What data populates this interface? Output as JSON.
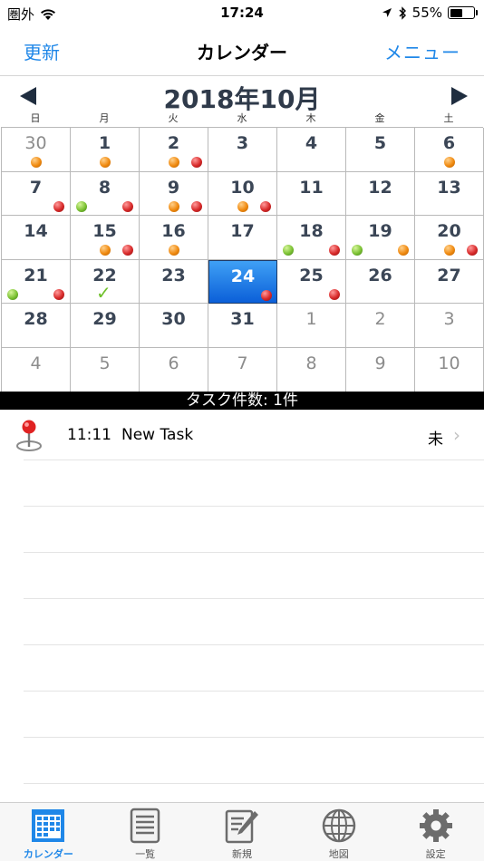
{
  "status": {
    "carrier": "圏外",
    "time": "17:24",
    "battery": "55%",
    "battery_level": 0.55,
    "icons": [
      "wifi-icon",
      "location-arrow-icon",
      "bluetooth-icon",
      "battery-icon"
    ]
  },
  "nav": {
    "left": "更新",
    "title": "カレンダー",
    "right": "メニュー"
  },
  "calendar": {
    "month_title": "2018年10月",
    "weekdays": [
      "日",
      "月",
      "火",
      "水",
      "木",
      "金",
      "土"
    ],
    "selected": "24",
    "weeks": [
      [
        {
          "d": "30",
          "other": true,
          "dots": [
            "orange"
          ]
        },
        {
          "d": "1",
          "dots": [
            "orange"
          ]
        },
        {
          "d": "2",
          "dots": [
            "orange",
            "red"
          ]
        },
        {
          "d": "3",
          "dots": []
        },
        {
          "d": "4",
          "dots": []
        },
        {
          "d": "5",
          "dots": []
        },
        {
          "d": "6",
          "dots": [
            "orange"
          ]
        }
      ],
      [
        {
          "d": "7",
          "dots": [
            "red"
          ]
        },
        {
          "d": "8",
          "dots": [
            "green",
            "red"
          ]
        },
        {
          "d": "9",
          "dots": [
            "orange",
            "red"
          ]
        },
        {
          "d": "10",
          "dots": [
            "orange",
            "red"
          ]
        },
        {
          "d": "11",
          "dots": []
        },
        {
          "d": "12",
          "dots": []
        },
        {
          "d": "13",
          "dots": []
        }
      ],
      [
        {
          "d": "14",
          "dots": []
        },
        {
          "d": "15",
          "dots": [
            "orange",
            "red"
          ]
        },
        {
          "d": "16",
          "dots": [
            "orange"
          ]
        },
        {
          "d": "17",
          "dots": []
        },
        {
          "d": "18",
          "dots": [
            "green",
            "red"
          ]
        },
        {
          "d": "19",
          "dots": [
            "green",
            "orange"
          ]
        },
        {
          "d": "20",
          "dots": [
            "orange",
            "red"
          ]
        }
      ],
      [
        {
          "d": "21",
          "dots": [
            "green",
            "red"
          ]
        },
        {
          "d": "22",
          "dots": [],
          "check": true
        },
        {
          "d": "23",
          "dots": []
        },
        {
          "d": "24",
          "dots": [
            "red"
          ],
          "selected": true
        },
        {
          "d": "25",
          "dots": [
            "red"
          ]
        },
        {
          "d": "26",
          "dots": []
        },
        {
          "d": "27",
          "dots": []
        }
      ],
      [
        {
          "d": "28",
          "dots": []
        },
        {
          "d": "29",
          "dots": []
        },
        {
          "d": "30",
          "dots": []
        },
        {
          "d": "31",
          "dots": []
        },
        {
          "d": "1",
          "other": true,
          "dots": []
        },
        {
          "d": "2",
          "other": true,
          "dots": []
        },
        {
          "d": "3",
          "other": true,
          "dots": []
        }
      ],
      [
        {
          "d": "4",
          "other": true,
          "dots": []
        },
        {
          "d": "5",
          "other": true,
          "dots": []
        },
        {
          "d": "6",
          "other": true,
          "dots": []
        },
        {
          "d": "7",
          "other": true,
          "dots": []
        },
        {
          "d": "8",
          "other": true,
          "dots": []
        },
        {
          "d": "9",
          "other": true,
          "dots": []
        },
        {
          "d": "10",
          "other": true,
          "dots": []
        }
      ]
    ]
  },
  "task_count": "タスク件数: 1件",
  "tasks": [
    {
      "time": "11:11",
      "name": "New Task",
      "status": "未",
      "icon": "map-pin-icon"
    }
  ],
  "tabs": [
    {
      "label": "カレンダー",
      "icon": "calendar-icon",
      "active": true
    },
    {
      "label": "一覧",
      "icon": "list-icon"
    },
    {
      "label": "新規",
      "icon": "new-note-icon"
    },
    {
      "label": "地図",
      "icon": "globe-icon"
    },
    {
      "label": "設定",
      "icon": "gear-icon"
    }
  ],
  "colors": {
    "accent": "#1f87e8",
    "selected_cell": "#1f6fe0",
    "dot_orange": "#f08a10",
    "dot_red": "#d82a2a",
    "dot_green": "#7cc234"
  }
}
